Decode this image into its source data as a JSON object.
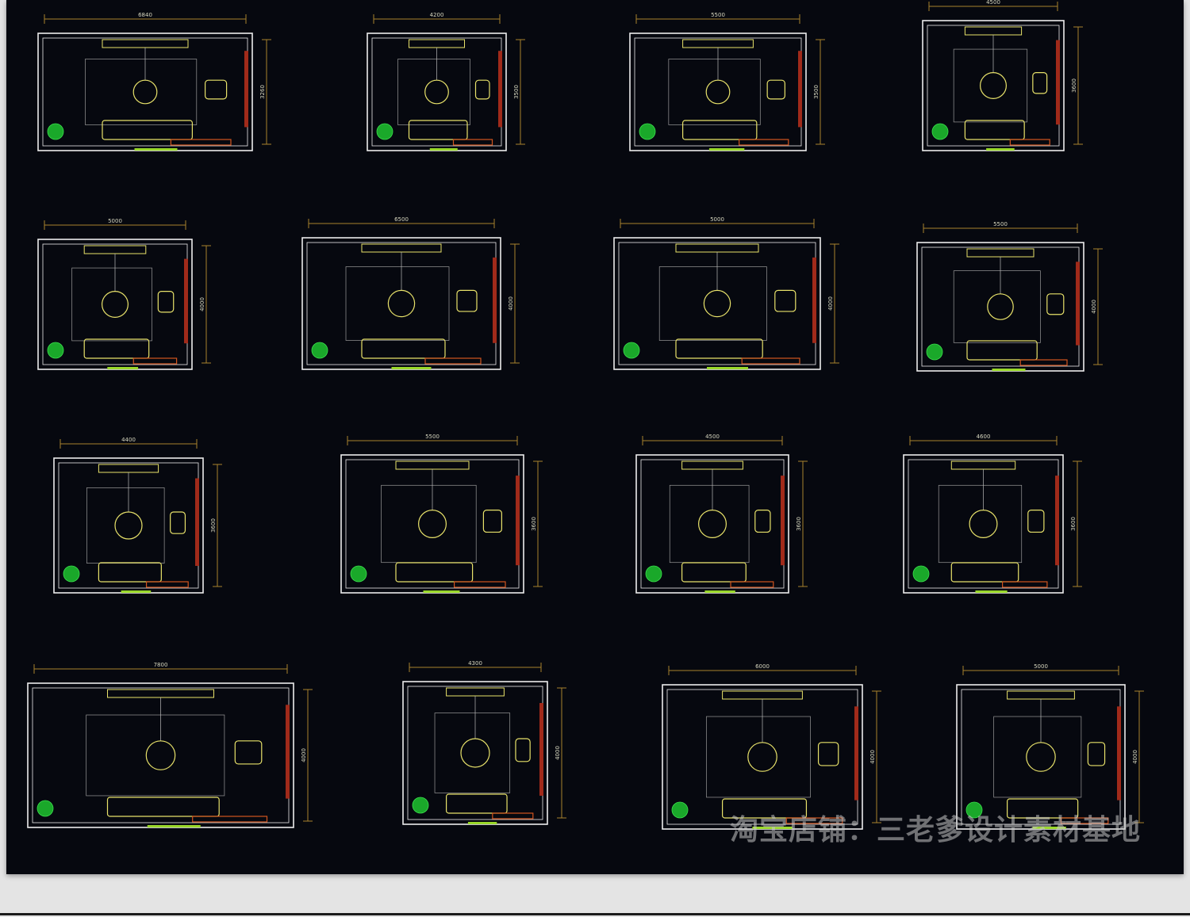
{
  "colors": {
    "background": "#06080f",
    "wall": "#ececec",
    "furniture": "#e8e26a",
    "dimension": "#a8822e",
    "window": "#a02a1a",
    "cabinet": "#d2541e",
    "plant": "#1aa82a",
    "door_green": "#9ad82a"
  },
  "plans": [
    {
      "width_label": "6840",
      "height_label": "3260"
    },
    {
      "width_label": "4200",
      "height_label": "3500"
    },
    {
      "width_label": "5500",
      "height_label": "3500"
    },
    {
      "width_label": "4500",
      "height_label": "3600"
    },
    {
      "width_label": "5000",
      "height_label": "4000"
    },
    {
      "width_label": "6500",
      "height_label": "4000"
    },
    {
      "width_label": "5000",
      "height_label": "4000"
    },
    {
      "width_label": "5500",
      "height_label": "4000"
    },
    {
      "width_label": "4400",
      "height_label": "3600"
    },
    {
      "width_label": "5500",
      "height_label": "3600"
    },
    {
      "width_label": "4500",
      "height_label": "3600"
    },
    {
      "width_label": "4600",
      "height_label": "3600"
    },
    {
      "width_label": "7800",
      "height_label": "4000"
    },
    {
      "width_label": "4300",
      "height_label": "4000"
    },
    {
      "width_label": "6000",
      "height_label": "4000"
    },
    {
      "width_label": "5000",
      "height_label": "4000"
    }
  ],
  "watermark": "淘宝店铺：三老爹设计素材基地"
}
